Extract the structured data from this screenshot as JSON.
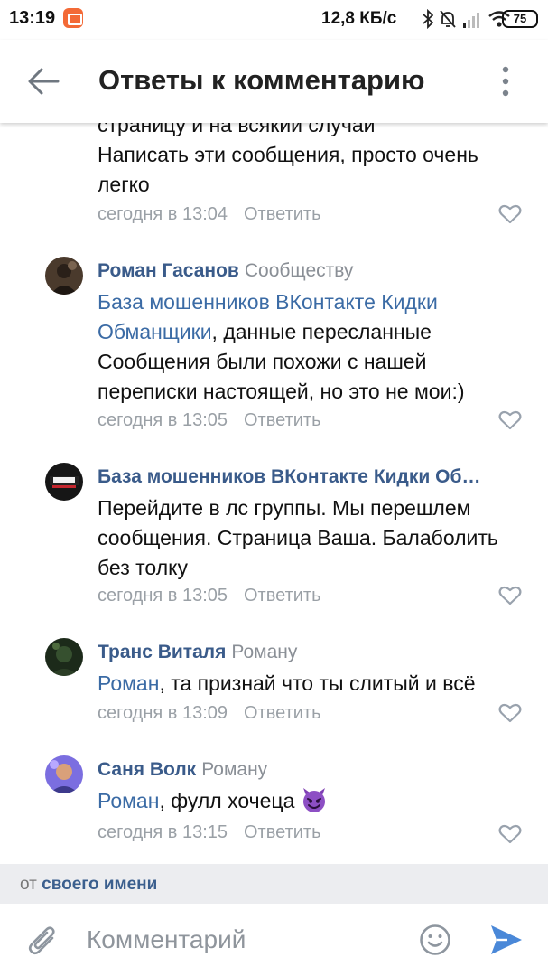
{
  "status_bar": {
    "time": "13:19",
    "network_speed": "12,8 КБ/с",
    "battery": "75",
    "icons": [
      "app-notification-icon",
      "bluetooth-icon",
      "mute-icon",
      "signal-icon",
      "wifi-icon"
    ]
  },
  "header": {
    "title": "Ответы к комментарию",
    "back_icon": "arrow-left-icon",
    "menu_icon": "more-vertical-icon"
  },
  "comments": [
    {
      "text_lines": [
        "страницу и на всякий случай",
        "Написать эти сообщения, просто очень",
        "легко"
      ],
      "time": "сегодня в 13:04",
      "reply_label": "Ответить"
    },
    {
      "author": "Роман Гасанов",
      "target": "Сообществу",
      "mention": "База мошенников ВКонтакте  Кидки Обманщики",
      "text": ", данные пересланные Сообщения были похожи с нашей переписки настоящей, но это не мои:)",
      "time": "сегодня в 13:05",
      "reply_label": "Ответить"
    },
    {
      "author": "База мошенников ВКонтакте  Кидки Об…",
      "text": "Перейдите в лс группы. Мы перешлем сообщения. Страница Ваша. Балаболить без толку",
      "time": "сегодня в 13:05",
      "reply_label": "Ответить"
    },
    {
      "author": "Транс Виталя",
      "target": "Роману",
      "mention": "Роман",
      "text": ", та признай что ты слитый и всё",
      "time": "сегодня в 13:09",
      "reply_label": "Ответить"
    },
    {
      "author": "Саня Волк",
      "target": "Роману",
      "mention": "Роман",
      "text": ", фулл хочеца",
      "emoji": "smiling-imp-emoji",
      "time": "сегодня в 13:15",
      "reply_label": "Ответить"
    }
  ],
  "composer": {
    "from_prefix": "от",
    "from_name": "своего имени",
    "placeholder": "Комментарий"
  },
  "colors": {
    "link": "#3b6ba5",
    "author": "#3a5b8a",
    "meta": "#9aa0a6",
    "accent": "#4a88d8"
  }
}
